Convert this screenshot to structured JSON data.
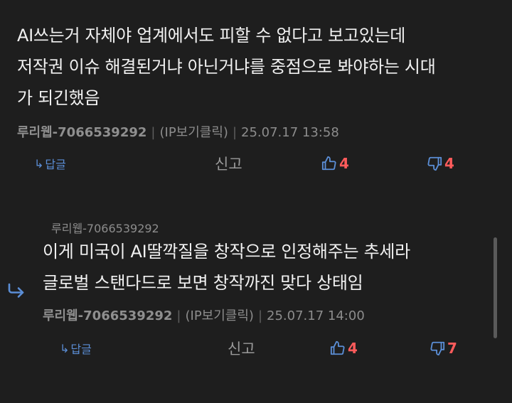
{
  "comments": [
    {
      "body": "AI쓰는거 자체야 업계에서도 피할 수 없다고 보고있는데\n저작권 이슈 해결된거냐 아닌거냐를 중점으로 봐야하는 시대\n가 되긴했음",
      "author": "루리웹-7066539292",
      "ip": "(IP보기클릭)",
      "date": "25.07.17 13:58",
      "reply_label": "답글",
      "report_label": "신고",
      "upvotes": "4",
      "downvotes": "4"
    },
    {
      "quote_author": "루리웹-7066539292",
      "body": "이게 미국이 AI딸깍질을 창작으로 인정해주는 추세라\n글로벌 스탠다드로 보면 창작까진 맞다 상태임",
      "author": "루리웹-7066539292",
      "ip": "(IP보기클릭)",
      "date": "25.07.17 14:00",
      "reply_label": "답글",
      "report_label": "신고",
      "upvotes": "4",
      "downvotes": "7"
    }
  ],
  "meta_separator": "|",
  "colors": {
    "background": "#1e1e1e",
    "accent_blue": "#5b8ed6",
    "vote_red": "#ff5b5b"
  }
}
